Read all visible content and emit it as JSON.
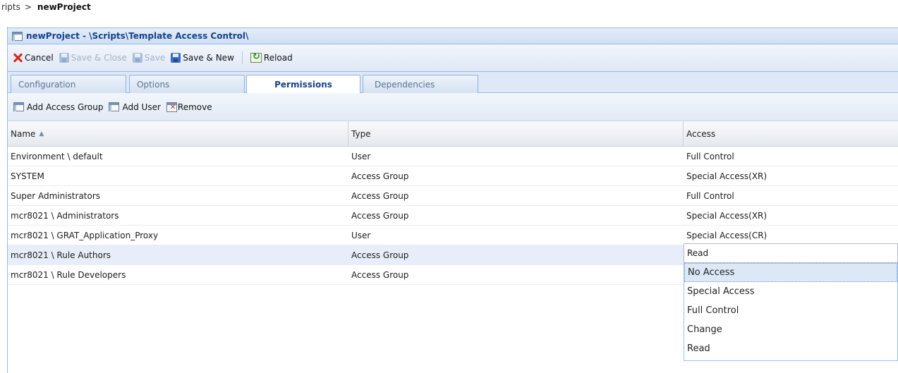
{
  "breadcrumb": {
    "parent": "ripts",
    "separator": ">",
    "current": "newProject"
  },
  "window": {
    "title": "newProject - \\Scripts\\Template Access Control\\"
  },
  "toolbar": {
    "cancel": "Cancel",
    "save_close": "Save & Close",
    "save": "Save",
    "save_new": "Save & New",
    "reload": "Reload"
  },
  "tabs": [
    {
      "label": "Configuration"
    },
    {
      "label": "Options"
    },
    {
      "label": "Permissions"
    },
    {
      "label": "Dependencies"
    }
  ],
  "grid_toolbar": {
    "add_access_group": "Add Access Group",
    "add_user": "Add User",
    "remove": "Remove"
  },
  "grid": {
    "columns": [
      "Name",
      "Type",
      "Access"
    ],
    "sort_indicator": "▲",
    "rows": [
      {
        "name": "Environment \\ default",
        "type": "User",
        "access": "Full Control"
      },
      {
        "name": "SYSTEM",
        "type": "Access Group",
        "access": "Special Access(XR)"
      },
      {
        "name": "Super Administrators",
        "type": "Access Group",
        "access": "Full Control"
      },
      {
        "name": "mcr8021 \\ Administrators",
        "type": "Access Group",
        "access": "Special Access(XR)"
      },
      {
        "name": "mcr8021 \\ GRAT_Application_Proxy",
        "type": "User",
        "access": "Special Access(CR)"
      },
      {
        "name": "mcr8021 \\ Rule Authors",
        "type": "Access Group",
        "access": ""
      },
      {
        "name": "mcr8021 \\ Rule Developers",
        "type": "Access Group",
        "access": ""
      }
    ]
  },
  "access_editor": {
    "value": "Read",
    "options": [
      "No Access",
      "Special Access",
      "Full Control",
      "Change",
      "Read"
    ]
  },
  "colors": {
    "accent": "#15428b",
    "border": "#99bbe8",
    "cancel": "#d8251b"
  }
}
